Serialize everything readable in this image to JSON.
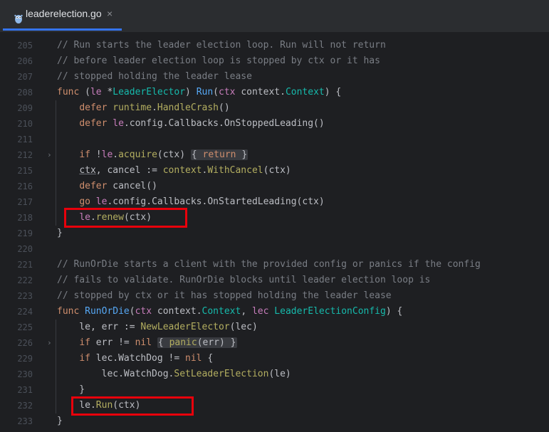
{
  "tab": {
    "title": "leaderelection.go",
    "close": "×",
    "icon": "gopher-icon"
  },
  "colors": {
    "accent": "#3574f0",
    "highlight": "#e8000b",
    "background": "#1e1f22"
  },
  "line_numbers": [
    "205",
    "206",
    "207",
    "208",
    "209",
    "210",
    "211",
    "212",
    "215",
    "216",
    "217",
    "218",
    "219",
    "220",
    "221",
    "222",
    "223",
    "224",
    "225",
    "226",
    "229",
    "230",
    "231",
    "232",
    "233"
  ],
  "code": {
    "l205": "// Run starts the leader election loop. Run will not return",
    "l206": "// before leader election loop is stopped by ctx or it has",
    "l207": "// stopped holding the leader lease",
    "l221": "// RunOrDie starts a client with the provided config or panics if the config",
    "l222": "// fails to validate. RunOrDie blocks until leader election loop is",
    "l223": "// stopped by ctx or it has stopped holding the leader lease"
  },
  "fold_markers": [
    "›",
    "›"
  ]
}
